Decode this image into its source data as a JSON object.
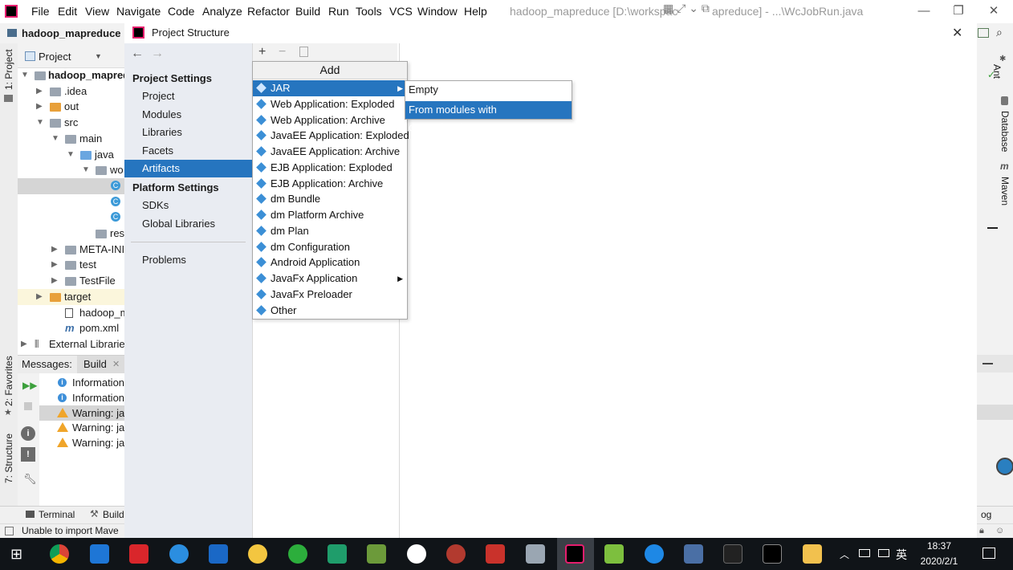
{
  "menubar": {
    "items": [
      "File",
      "Edit",
      "View",
      "Navigate",
      "Code",
      "Analyze",
      "Refactor",
      "Build",
      "Run",
      "Tools",
      "VCS",
      "Window",
      "Help"
    ],
    "window_title": "hadoop_mapreduce [D:\\workspac",
    "window_title_rest": "apreduce] - ...\\WcJobRun.java"
  },
  "navbar": {
    "project_name": "hadoop_mapreduce"
  },
  "leftstrip": {
    "project_tab": "1: Project",
    "favorites_tab": "2: Favorites",
    "structure_tab": "7: Structure"
  },
  "project_pane": {
    "header": "Project",
    "tree": [
      {
        "label": "hadoop_mapred",
        "arrow": "down",
        "depth": 0,
        "kind": "project"
      },
      {
        "label": ".idea",
        "arrow": "right",
        "depth": 1,
        "kind": "folder"
      },
      {
        "label": "out",
        "arrow": "right",
        "depth": 1,
        "kind": "folder-orange"
      },
      {
        "label": "src",
        "arrow": "down",
        "depth": 1,
        "kind": "folder"
      },
      {
        "label": "main",
        "arrow": "down",
        "depth": 2,
        "kind": "folder"
      },
      {
        "label": "java",
        "arrow": "down",
        "depth": 3,
        "kind": "folder-blue"
      },
      {
        "label": "wo",
        "arrow": "down",
        "depth": 4,
        "kind": "package"
      },
      {
        "label": "",
        "arrow": "",
        "depth": 5,
        "kind": "class",
        "selected": true
      },
      {
        "label": "",
        "arrow": "",
        "depth": 5,
        "kind": "class"
      },
      {
        "label": "",
        "arrow": "",
        "depth": 5,
        "kind": "class"
      },
      {
        "label": "resour",
        "arrow": "",
        "depth": 4,
        "kind": "folder"
      },
      {
        "label": "META-INI",
        "arrow": "right",
        "depth": 2,
        "kind": "folder"
      },
      {
        "label": "test",
        "arrow": "right",
        "depth": 2,
        "kind": "folder"
      },
      {
        "label": "TestFile",
        "arrow": "right",
        "depth": 2,
        "kind": "folder"
      },
      {
        "label": "target",
        "arrow": "right",
        "depth": 1,
        "kind": "folder-orange",
        "highlight": true
      },
      {
        "label": "hadoop_map",
        "arrow": "",
        "depth": 2,
        "kind": "file"
      },
      {
        "label": "pom.xml",
        "arrow": "",
        "depth": 2,
        "kind": "maven"
      },
      {
        "label": "External Libraries",
        "arrow": "right",
        "depth": 0,
        "kind": "lib"
      }
    ]
  },
  "messages": {
    "label": "Messages:",
    "tab": "Build",
    "rows": [
      {
        "type": "info",
        "text": "Information"
      },
      {
        "type": "info",
        "text": "Information"
      },
      {
        "type": "warn",
        "text": "Warning: ja",
        "selected": true
      },
      {
        "type": "warn",
        "text": "Warning: ja"
      },
      {
        "type": "warn",
        "text": "Warning: ja"
      }
    ]
  },
  "toolstrip": {
    "terminal": "Terminal",
    "build": "Build",
    "right_text": "og"
  },
  "statusbar": {
    "text": "Unable to import Mave"
  },
  "rightstrip": {
    "ant": "Ant",
    "database": "Database",
    "maven": "Maven"
  },
  "dialog": {
    "title": "Project Structure",
    "project_settings_header": "Project Settings",
    "project_settings": [
      "Project",
      "Modules",
      "Libraries",
      "Facets",
      "Artifacts"
    ],
    "selected": "Artifacts",
    "platform_settings_header": "Platform Settings",
    "platform_settings": [
      "SDKs",
      "Global Libraries"
    ],
    "problems": "Problems"
  },
  "add_popup": {
    "title": "Add",
    "items": [
      {
        "label": "JAR",
        "selected": true,
        "submenu": true
      },
      {
        "label": "Web Application: Exploded"
      },
      {
        "label": "Web Application: Archive"
      },
      {
        "label": "JavaEE Application: Exploded"
      },
      {
        "label": "JavaEE Application: Archive"
      },
      {
        "label": "EJB Application: Exploded"
      },
      {
        "label": "EJB Application: Archive"
      },
      {
        "label": "dm Bundle"
      },
      {
        "label": "dm Platform Archive"
      },
      {
        "label": "dm Plan"
      },
      {
        "label": "dm Configuration"
      },
      {
        "label": "Android Application"
      },
      {
        "label": "JavaFx Application",
        "submenu": true
      },
      {
        "label": "JavaFx Preloader"
      },
      {
        "label": "Other"
      }
    ]
  },
  "jar_submenu": {
    "items": [
      {
        "label": "Empty"
      },
      {
        "label": "From modules with dependencies...",
        "selected": true
      }
    ]
  },
  "taskbar": {
    "time": "18:37",
    "date": "2020/2/1",
    "ime": "英"
  },
  "colors": {
    "selection": "#2675bf",
    "nav_bg": "#e9ecf2",
    "taskbar": "#101418"
  }
}
